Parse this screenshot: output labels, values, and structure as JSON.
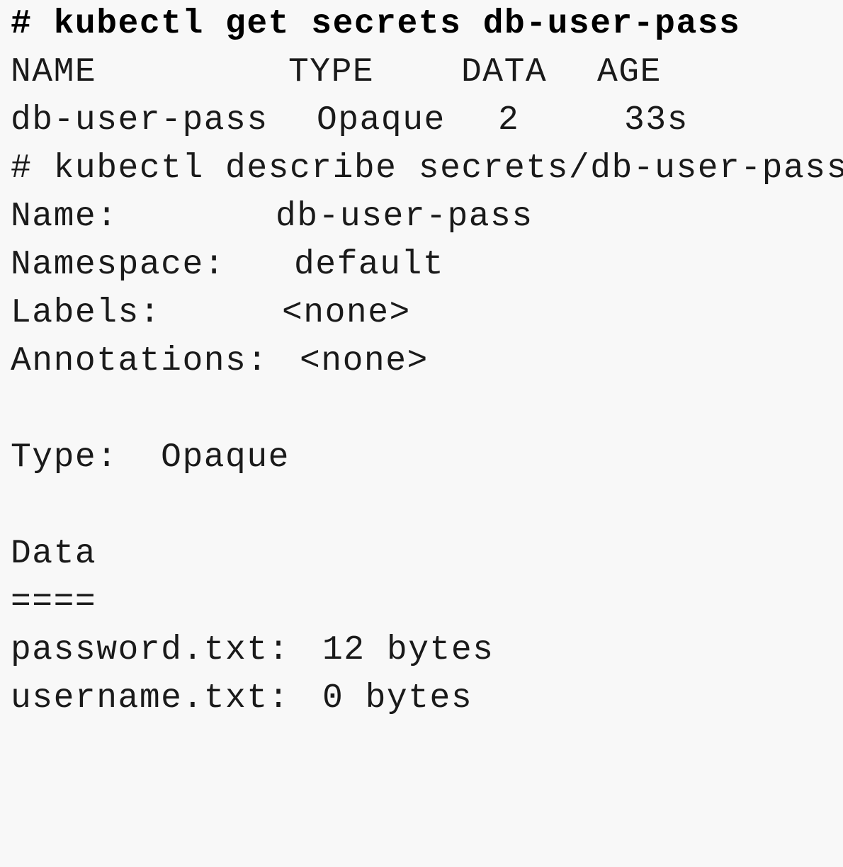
{
  "terminal": {
    "command1": "# kubectl get secrets db-user-pass",
    "table": {
      "headers": {
        "name": "NAME",
        "type": "TYPE",
        "data": "DATA",
        "age": "AGE"
      },
      "rows": [
        {
          "name": "db-user-pass",
          "type": "Opaque",
          "data": "2",
          "age": "33s"
        }
      ]
    },
    "command2": "# kubectl describe secrets/db-user-pass",
    "describe": {
      "name_label": "Name:",
      "name_value": "db-user-pass",
      "namespace_label": "Namespace:",
      "namespace_value": "default",
      "labels_label": "Labels:",
      "labels_value": "<none>",
      "annotations_label": "Annotations:",
      "annotations_value": "<none>",
      "type_line": "Type:  Opaque",
      "data_heading": "Data",
      "data_underline": "====",
      "entries": [
        {
          "key": "password.txt:",
          "value": "12 bytes"
        },
        {
          "key": "username.txt:",
          "value": "0 bytes"
        }
      ]
    }
  }
}
